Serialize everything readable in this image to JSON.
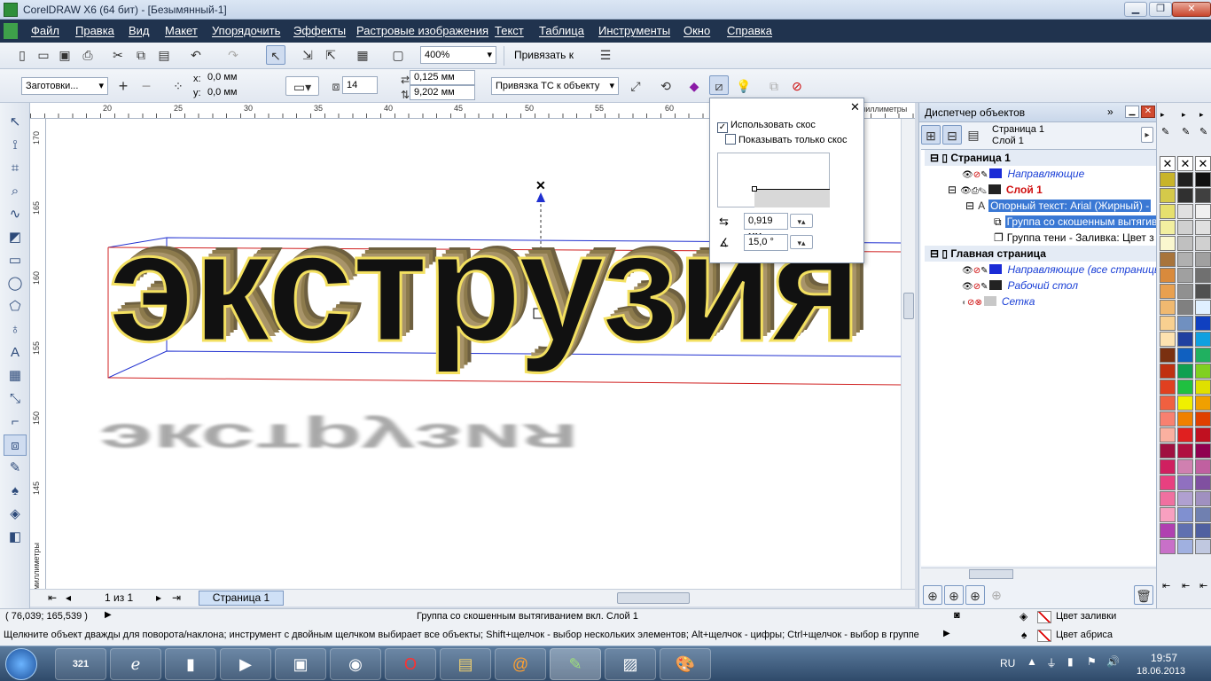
{
  "window": {
    "title": "CorelDRAW X6 (64 бит) - [Безымянный-1]"
  },
  "menu": [
    "Файл",
    "Правка",
    "Вид",
    "Макет",
    "Упорядочить",
    "Эффекты",
    "Растровые изображения",
    "Текст",
    "Таблица",
    "Инструменты",
    "Окно",
    "Справка"
  ],
  "toolbar1": {
    "zoom": "400%",
    "snap": "Привязать к"
  },
  "toolbar2": {
    "presets": "Заготовки...",
    "x_label": "x:",
    "x": "0,0 мм",
    "y_label": "y:",
    "y": "0,0 мм",
    "depth": "14",
    "vp_x": "0,125 мм",
    "vp_y": "9,202 мм",
    "vp_lock": "Привязка ТС к объекту"
  },
  "ruler": {
    "units": "миллиметры",
    "h_ticks": [
      "20",
      "25",
      "30",
      "35",
      "40",
      "45",
      "50",
      "55",
      "60"
    ],
    "v_ticks": [
      "170",
      "165",
      "160",
      "155",
      "150",
      "145"
    ],
    "v_units": "миллиметры"
  },
  "canvas": {
    "main_text": "экструзия",
    "shadow_text": "экструзия"
  },
  "bevel_popup": {
    "use_bevel": "Использовать скос",
    "show_only": "Показывать только скос",
    "depth": "0,919 мм",
    "angle": "15,0 °"
  },
  "docker": {
    "title": "Диспетчер объектов",
    "page": "Страница 1",
    "layer": "Слой 1",
    "tree": [
      {
        "label": "Страница 1",
        "bold": true
      },
      {
        "label": "Направляющие",
        "color": "#1a3fd6",
        "italic": true
      },
      {
        "label": "Слой 1",
        "color": "#d01010",
        "bold": true
      },
      {
        "label": "Опорный текст: Arial (Жирный) -",
        "selected": true
      },
      {
        "label": "Группа со скошенным вытягиванием",
        "selected": true
      },
      {
        "label": "Группа тени  - Заливка: Цвет з"
      },
      {
        "label": "Главная страница",
        "bold": true
      },
      {
        "label": "Направляющие (все страницы)",
        "color": "#1a3fd6",
        "italic": true
      },
      {
        "label": "Рабочий стол",
        "color": "#1a3fd6",
        "italic": true
      },
      {
        "label": "Сетка",
        "color": "#1a3fd6",
        "italic": true
      }
    ]
  },
  "pager": {
    "pages": "1 из 1",
    "tab": "Страница 1"
  },
  "status": {
    "coords": "( 76,039; 165,539 )",
    "object": "Группа со скошенным вытягиванием вкл. Слой 1",
    "fill": "Цвет заливки",
    "outline": "Цвет абриса",
    "hint": "Щелкните объект дважды для поворота/наклона; инструмент с двойным щелчком выбирает все объекты; Shift+щелчок - выбор нескольких элементов; Alt+щелчок - цифры; Ctrl+щелчок - выбор в группе"
  },
  "taskbar": {
    "lang": "RU",
    "time": "19:57",
    "date": "18.06.2013",
    "calendar": "321"
  },
  "palette": {
    "col1": [
      "#c8b42a",
      "#d4c94a",
      "#e6e06e",
      "#f2efa0",
      "#faf7cf",
      "#a8743c",
      "#d98a3c",
      "#e8a050",
      "#f0b970",
      "#f8d090",
      "#fde2b0",
      "#7a3010",
      "#c03010",
      "#e04020",
      "#f06040",
      "#f88070",
      "#fab0a0",
      "#a01040",
      "#d02060",
      "#e84080",
      "#f070a0",
      "#f8a0c0",
      "#b040b0",
      "#c870c8"
    ],
    "col2": [
      "#202020",
      "#303030",
      "#e0e0e0",
      "#d0d0d0",
      "#c0c0c0",
      "#b0b0b0",
      "#a0a0a0",
      "#909090",
      "#808080",
      "#7090c0",
      "#2040a0",
      "#1060c0",
      "#10a050",
      "#20c040",
      "#f0f000",
      "#f08000",
      "#e02020",
      "#b01040",
      "#d080b0",
      "#9070c0",
      "#b0a0d0",
      "#8090d0",
      "#6070b0",
      "#a0b0e0"
    ],
    "col3": [
      "#101010",
      "#404040",
      "#f0f0f0",
      "#e0e0e0",
      "#d0d0d0",
      "#a0a0a0",
      "#707070",
      "#505050",
      "#e0f0ff",
      "#1040c0",
      "#10a0e0",
      "#20b060",
      "#80d020",
      "#e0e000",
      "#f0a000",
      "#e04000",
      "#c01020",
      "#900050",
      "#c060a0",
      "#8050a0",
      "#a090c0",
      "#7080b0",
      "#5060a0",
      "#c0c8e0"
    ]
  }
}
